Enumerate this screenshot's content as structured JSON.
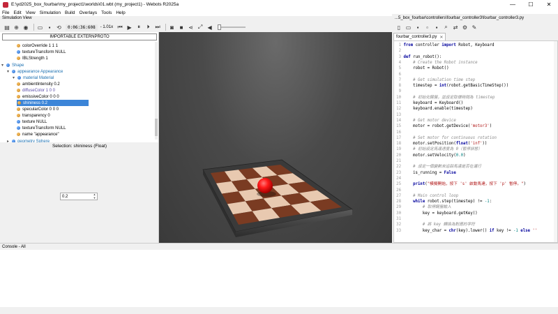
{
  "window": {
    "title": "E:\\yd2025_box_fourbar\\my_project1\\worlds\\01.wbt (my_project1) - Webots R2025a",
    "minimize": "—",
    "maximize": "☐",
    "close": "✕"
  },
  "menu": [
    "File",
    "Edit",
    "View",
    "Simulation",
    "Build",
    "Overlays",
    "Tools",
    "Help"
  ],
  "sim_view_label": "Simulation View",
  "toolbar": {
    "time": "0:06:36:608",
    "speed": "- 1.01x"
  },
  "scene_tree": {
    "proto_button": "IMPORTABLE EXTERNPROTO",
    "rows": [
      {
        "label": "colorOverride 1 1 1",
        "bullet": "orange"
      },
      {
        "label": "textureTransform NULL",
        "bullet": "blue"
      },
      {
        "label": "IBLStrength 1",
        "bullet": "orange"
      },
      {
        "label": "Shape",
        "bullet": "blue",
        "caret": "▾"
      },
      {
        "label": "appearance Appearance",
        "bullet": "blue",
        "caret": "▾"
      },
      {
        "label": "material Material",
        "bullet": "blue",
        "caret": "▾"
      },
      {
        "label": "ambientIntensity 0.2",
        "bullet": "orange"
      },
      {
        "label": "diffuseColor 1 0 0",
        "bullet": "orange"
      },
      {
        "label": "emissiveColor 0 0 0",
        "bullet": "orange"
      },
      {
        "label": "shininess 0.2",
        "bullet": "orange",
        "selected": true
      },
      {
        "label": "specularColor 0 0 0",
        "bullet": "orange"
      },
      {
        "label": "transparency 0",
        "bullet": "orange"
      },
      {
        "label": "texture NULL",
        "bullet": "blue"
      },
      {
        "label": "textureTransform NULL",
        "bullet": "blue"
      },
      {
        "label": "name \"appearance\"",
        "bullet": "orange"
      },
      {
        "label": "geometry Sphere",
        "bullet": "blue",
        "caret": "▸"
      }
    ]
  },
  "inspector": {
    "title": "Selection: shininess (Float)",
    "value": "0.2"
  },
  "editor": {
    "path": "...5_box_fourbar\\controllers\\fourbar_controller3\\fourbar_controller3.py",
    "tab": "fourbar_controller3.py",
    "tab_close": "✕",
    "lines": [
      {
        "n": "1",
        "segments": [
          {
            "t": "from ",
            "c": "kw"
          },
          {
            "t": "controller ",
            "c": "fn"
          },
          {
            "t": "import ",
            "c": "kw"
          },
          {
            "t": "Robot, Keyboard",
            "c": "fn"
          }
        ]
      },
      {
        "n": "2",
        "segments": []
      },
      {
        "n": "3",
        "segments": [
          {
            "t": "def ",
            "c": "kw"
          },
          {
            "t": "run_robot():",
            "c": "fn"
          }
        ]
      },
      {
        "n": "4",
        "segments": [
          {
            "t": "    # Create the Robot instance",
            "c": "cm"
          }
        ]
      },
      {
        "n": "5",
        "segments": [
          {
            "t": "    robot = Robot()",
            "c": "fn"
          }
        ]
      },
      {
        "n": "6",
        "segments": []
      },
      {
        "n": "7",
        "segments": [
          {
            "t": "    # Get simulation time step",
            "c": "cm"
          }
        ]
      },
      {
        "n": "8",
        "segments": [
          {
            "t": "    timestep = ",
            "c": "fn"
          },
          {
            "t": "int",
            "c": "kw"
          },
          {
            "t": "(robot.getBasicTimeStep())",
            "c": "fn"
          }
        ]
      },
      {
        "n": "9",
        "segments": []
      },
      {
        "n": "10",
        "segments": [
          {
            "t": "    # 初始化鍵盤，並設定取樣時間為 timestep",
            "c": "cm"
          }
        ]
      },
      {
        "n": "11",
        "segments": [
          {
            "t": "    keyboard = Keyboard()",
            "c": "fn"
          }
        ]
      },
      {
        "n": "12",
        "segments": [
          {
            "t": "    keyboard.enable(timestep)",
            "c": "fn"
          }
        ]
      },
      {
        "n": "13",
        "segments": []
      },
      {
        "n": "14",
        "segments": [
          {
            "t": "    # Get motor device",
            "c": "cm"
          }
        ]
      },
      {
        "n": "15",
        "segments": [
          {
            "t": "    motor = robot.getDevice(",
            "c": "fn"
          },
          {
            "t": "'motor3'",
            "c": "st"
          },
          {
            "t": ")",
            "c": "fn"
          }
        ]
      },
      {
        "n": "16",
        "segments": []
      },
      {
        "n": "17",
        "segments": [
          {
            "t": "    # Set motor for continuous rotation",
            "c": "cm"
          }
        ]
      },
      {
        "n": "18",
        "segments": [
          {
            "t": "    motor.setPosition(",
            "c": "fn"
          },
          {
            "t": "float",
            "c": "kw"
          },
          {
            "t": "(",
            "c": "fn"
          },
          {
            "t": "'inf'",
            "c": "st"
          },
          {
            "t": "))",
            "c": "fn"
          }
        ]
      },
      {
        "n": "19",
        "segments": [
          {
            "t": "    # 初始設定馬達速度為 0（暫停狀態）",
            "c": "cm"
          }
        ]
      },
      {
        "n": "20",
        "segments": [
          {
            "t": "    motor.setVelocity(",
            "c": "fn"
          },
          {
            "t": "0.0",
            "c": "nm"
          },
          {
            "t": ")",
            "c": "fn"
          }
        ]
      },
      {
        "n": "21",
        "segments": []
      },
      {
        "n": "22",
        "segments": [
          {
            "t": "    # 設定一個變數來追踪馬達是否在運行",
            "c": "cm"
          }
        ]
      },
      {
        "n": "23",
        "segments": [
          {
            "t": "    is_running = ",
            "c": "fn"
          },
          {
            "t": "False",
            "c": "kw"
          }
        ]
      },
      {
        "n": "24",
        "segments": []
      },
      {
        "n": "25",
        "segments": [
          {
            "t": "    ",
            "c": "fn"
          },
          {
            "t": "print",
            "c": "kw"
          },
          {
            "t": "(",
            "c": "fn"
          },
          {
            "t": "\"模擬開始，按下 's' 啟動馬達，按下 'p' 暫停。\"",
            "c": "st"
          },
          {
            "t": ")",
            "c": "fn"
          }
        ]
      },
      {
        "n": "26",
        "segments": []
      },
      {
        "n": "27",
        "segments": [
          {
            "t": "    # Main control loop",
            "c": "cm"
          }
        ]
      },
      {
        "n": "28",
        "segments": [
          {
            "t": "    ",
            "c": "fn"
          },
          {
            "t": "while ",
            "c": "kw"
          },
          {
            "t": "robot.step(timestep) != ",
            "c": "fn"
          },
          {
            "t": "-1",
            "c": "nm"
          },
          {
            "t": ":",
            "c": "fn"
          }
        ]
      },
      {
        "n": "29",
        "segments": [
          {
            "t": "        # 取得鍵盤輸入",
            "c": "cm"
          }
        ]
      },
      {
        "n": "30",
        "segments": [
          {
            "t": "        key = keyboard.getKey()",
            "c": "fn"
          }
        ]
      },
      {
        "n": "31",
        "segments": []
      },
      {
        "n": "32",
        "segments": [
          {
            "t": "        # 將 key 轉換為對應的字符",
            "c": "cm"
          }
        ]
      },
      {
        "n": "33",
        "segments": [
          {
            "t": "        key_char = ",
            "c": "fn"
          },
          {
            "t": "chr",
            "c": "kw"
          },
          {
            "t": "(key).lower() ",
            "c": "fn"
          },
          {
            "t": "if ",
            "c": "kw"
          },
          {
            "t": "key != ",
            "c": "fn"
          },
          {
            "t": "-1 ",
            "c": "nm"
          },
          {
            "t": "else ",
            "c": "kw"
          },
          {
            "t": "''",
            "c": "st"
          }
        ]
      }
    ]
  },
  "console": {
    "label": "Console - All"
  },
  "colors": {
    "selection": "#3c85d8",
    "ball": "#ff1a1a",
    "floor_dark": "#7a3b22",
    "floor_light": "#e8c9b0"
  }
}
